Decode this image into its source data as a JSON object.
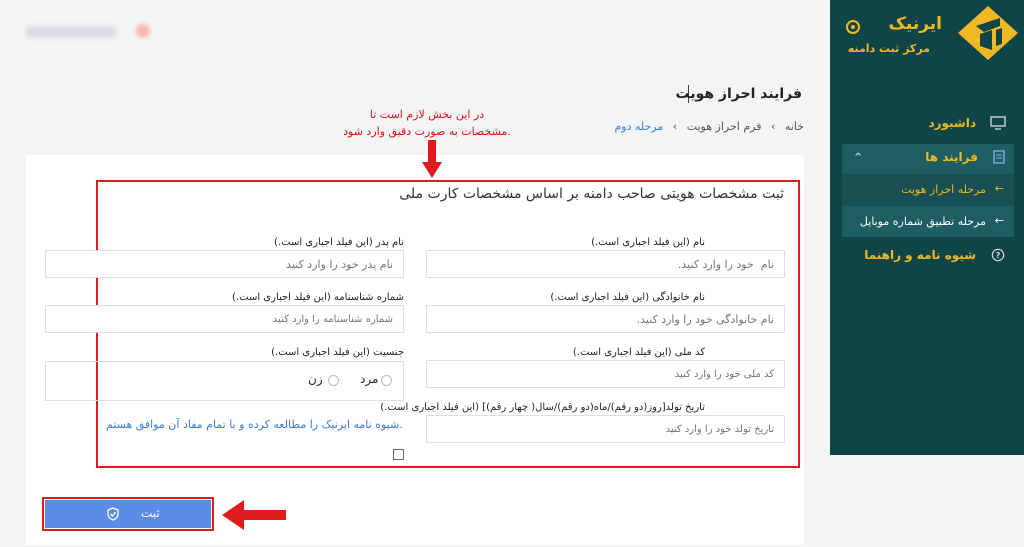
{
  "brand": {
    "name": "ایرنیک",
    "subtitle": "مرکز ثبت دامنه"
  },
  "nav": {
    "dashboard": "داشبورد",
    "processes": "فرایند ها",
    "sub_identity": "مرحله احراز هویت",
    "sub_mobile": "مرحله تطبیق شماره موبایل",
    "guide": "شیوه نامه و راهنما"
  },
  "page": {
    "title": "فرایند احراز هویت",
    "breadcrumb": [
      "خانه",
      "فرم احراز هویت",
      "مرحله دوم"
    ]
  },
  "annotation": {
    "line1": "در این بخش لازم است تا",
    "line2": "مشخصات به صورت دقیق وارد شود."
  },
  "form": {
    "title": "ثبت مشخصات هویتی صاحب دامنه بر اساس مشخصات کارت ملی",
    "first_name_label": "نام (این فیلد اجباری است.)",
    "first_name_placeholder": "نام  خود را وارد کنید.",
    "father_name_label": "نام پدر (این فیلد اجباری است.)",
    "father_name_placeholder": "نام پدر خود را وارد کنید",
    "last_name_label": "نام خانوادگی (این فیلد اجباری است.)",
    "last_name_placeholder": "نام خانوادگی خود را وارد کنید.",
    "id_number_label": "شماره شناسنامه (این فیلد اجباری است.)",
    "id_number_placeholder": "شماره شناسنامه را وارد کنید",
    "national_code_label": "کد ملی (این فیلد اجباری است.)",
    "national_code_placeholder": "کد ملی خود را وارد کنید",
    "gender_label": "جنسیت (این فیلد اجباری است.)",
    "gender_male": "مرد",
    "gender_female": "زن",
    "birthdate_label": "تاریخ تولد[روز(دو رقم)/ماه(دو رقم)/سال( چهار رقم)] (این فیلد اجباری است.)",
    "birthdate_placeholder": "تاریخ تولد خود را وارد کنید",
    "terms": "شیوه نامه ایرنیک را مطالعه کرده و با تمام مفاد آن موافق هستم.",
    "submit": "ثبت"
  },
  "colors": {
    "sidebar_bg": "#0f4547",
    "accent": "#f2b824",
    "primary_button": "#5b8ce6",
    "highlight_red": "#e01b1b"
  }
}
